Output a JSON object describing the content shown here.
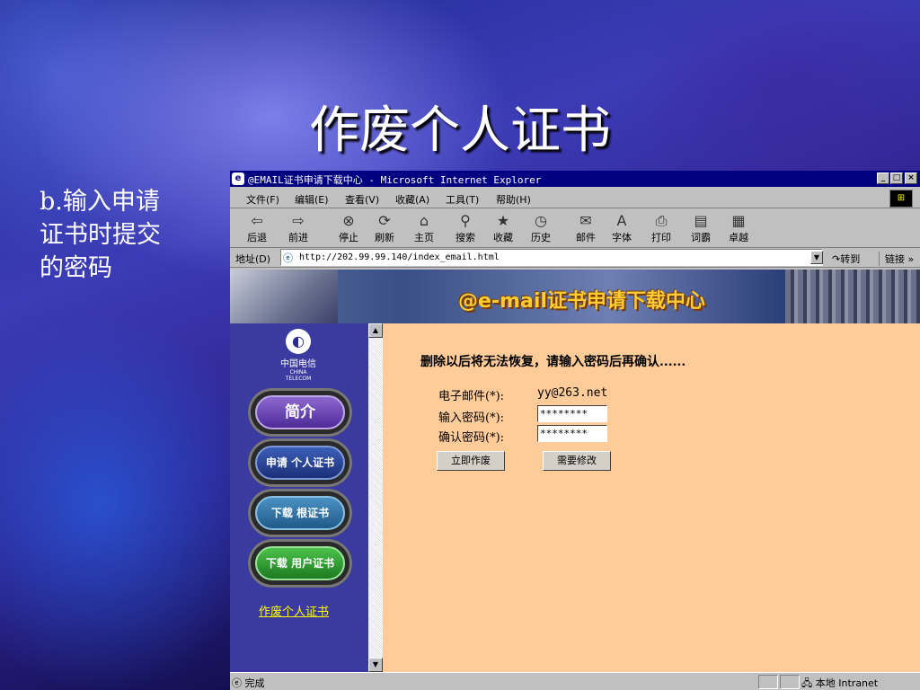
{
  "slide": {
    "title": "作废个人证书",
    "side_text": "b.输入申请证书时提交的密码"
  },
  "window": {
    "title": "@EMAIL证书申请下载中心 - Microsoft Internet Explorer",
    "min": "_",
    "max": "□",
    "close": "×"
  },
  "menu": [
    "文件(F)",
    "编辑(E)",
    "查看(V)",
    "收藏(A)",
    "工具(T)",
    "帮助(H)"
  ],
  "toolbar": [
    {
      "label": "后退",
      "icon": "back-arrow-icon",
      "glyph": "⇦"
    },
    {
      "label": "前进",
      "icon": "forward-arrow-icon",
      "glyph": "⇨"
    },
    {
      "label": "停止",
      "icon": "stop-icon",
      "glyph": "⊗"
    },
    {
      "label": "刷新",
      "icon": "refresh-icon",
      "glyph": "⟳"
    },
    {
      "label": "主页",
      "icon": "home-icon",
      "glyph": "⌂"
    },
    {
      "label": "搜索",
      "icon": "search-icon",
      "glyph": "⚲"
    },
    {
      "label": "收藏",
      "icon": "favorites-icon",
      "glyph": "★"
    },
    {
      "label": "历史",
      "icon": "history-icon",
      "glyph": "◷"
    },
    {
      "label": "邮件",
      "icon": "mail-icon",
      "glyph": "✉"
    },
    {
      "label": "字体",
      "icon": "font-icon",
      "glyph": "A"
    },
    {
      "label": "打印",
      "icon": "print-icon",
      "glyph": "⎙"
    },
    {
      "label": "词霸",
      "icon": "dictionary-icon",
      "glyph": "▤"
    },
    {
      "label": "卓越",
      "icon": "joyo-icon",
      "glyph": "▦"
    }
  ],
  "address": {
    "label": "地址(D)",
    "url": "http://202.99.99.140/index_email.html",
    "go": "转到",
    "links": "链接 »"
  },
  "page": {
    "banner_title": "@e-mail证书申请下载中心",
    "logo_cn": "中国电信",
    "logo_en": "CHINA TELECOM",
    "nav": [
      "简介",
      "申请 个人证书",
      "下载 根证书",
      "下载 用户证书"
    ],
    "side_link": "作废个人证书",
    "message": "删除以后将无法恢复，请输入密码后再确认......",
    "email_label": "电子邮件(*):",
    "email_value": "yy@263.net",
    "password_label": "输入密码(*):",
    "password_value": "********",
    "confirm_label": "确认密码(*):",
    "confirm_value": "********",
    "revoke_button": "立即作废",
    "modify_button": "需要修改"
  },
  "status": {
    "text": "完成",
    "zone": "本地 Intranet"
  }
}
